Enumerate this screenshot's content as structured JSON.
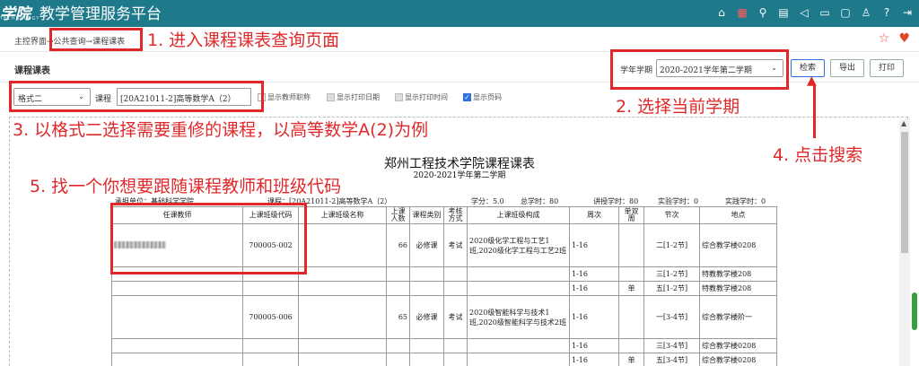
{
  "app": {
    "logo": "学院",
    "logo_sub": "TECHNOLOGY",
    "title": "教学管理服务平台"
  },
  "topbar_icons": [
    "home-icon",
    "grid-icon",
    "search-icon",
    "calendar-icon",
    "speaker-icon",
    "folder-icon",
    "chat-icon",
    "shirt-icon",
    "help-icon",
    "logout-icon"
  ],
  "breadcrumb": "主控界面→公共查询→课程课表",
  "section_title": "课程课表",
  "term": {
    "label": "学年学期",
    "selected": "2020-2021学年第二学期"
  },
  "buttons": {
    "search": "检索",
    "export": "导出",
    "print": "打印"
  },
  "filters": {
    "format_selected": "格式二",
    "course_label": "课程",
    "course_value": "[20A21011-2]高等数学A（2）",
    "checkboxes": [
      {
        "label": "显示教师职称",
        "checked": false
      },
      {
        "label": "显示打印日期",
        "checked": false
      },
      {
        "label": "显示打印时间",
        "checked": false
      },
      {
        "label": "显示页码",
        "checked": true
      }
    ]
  },
  "document": {
    "title": "郑州工程技术学院课程课表",
    "subtitle": "2020-2021学年第二学期",
    "unit": "承担单位：基础科学学院",
    "course": "课程：[20A21011-2]高等数学A（2）",
    "credits": "学分：5.0",
    "total_hours": "总学时：80",
    "lecture_hours": "讲授学时：80",
    "lab_hours": "实验学时：0",
    "practice_hours": "实践学时：0",
    "headers": [
      "任课教师",
      "上课班级代码",
      "上课班级名称",
      "上课人数",
      "课程类别",
      "考核方式",
      "上课班级构成",
      "周次",
      "单双周",
      "节次",
      "地点"
    ],
    "rows": [
      [
        "",
        "700005-002",
        "",
        "66",
        "必修课",
        "考试",
        "2020级化学工程与工艺1班,2020级化学工程与工艺2班",
        "1-16",
        "",
        "二[1-2节]",
        "综合教学楼0208"
      ],
      [
        "",
        "",
        "",
        "",
        "",
        "",
        "",
        "1-16",
        "",
        "三[1-2节]",
        "特教教学楼208"
      ],
      [
        "",
        "",
        "",
        "",
        "",
        "",
        "",
        "1-16",
        "单",
        "五[1-2节]",
        "特教教学楼208"
      ],
      [
        "",
        "700005-006",
        "",
        "65",
        "必修课",
        "考试",
        "2020级智能科学与技术1班,2020级智能科学与技术2班",
        "1-16",
        "",
        "一[3-4节]",
        "综合教学楼阶一"
      ],
      [
        "",
        "",
        "",
        "",
        "",
        "",
        "",
        "1-16",
        "",
        "三[3-4节]",
        "综合教学楼0208"
      ],
      [
        "",
        "",
        "",
        "",
        "",
        "",
        "",
        "1-16",
        "单",
        "五[3-4节]",
        "综合教学楼0208"
      ]
    ]
  },
  "annotations": {
    "a1": "1. 进入课程课表查询页面",
    "a2": "2. 选择当前学期",
    "a3": "3. 以格式二选择需要重修的课程，以高等数学A(2)为例",
    "a4": "4. 点击搜索",
    "a5": "5. 找一个你想要跟随课程教师和班级代码"
  },
  "colors": {
    "header": "#1e7a8a",
    "annotation": "#e0282a"
  }
}
